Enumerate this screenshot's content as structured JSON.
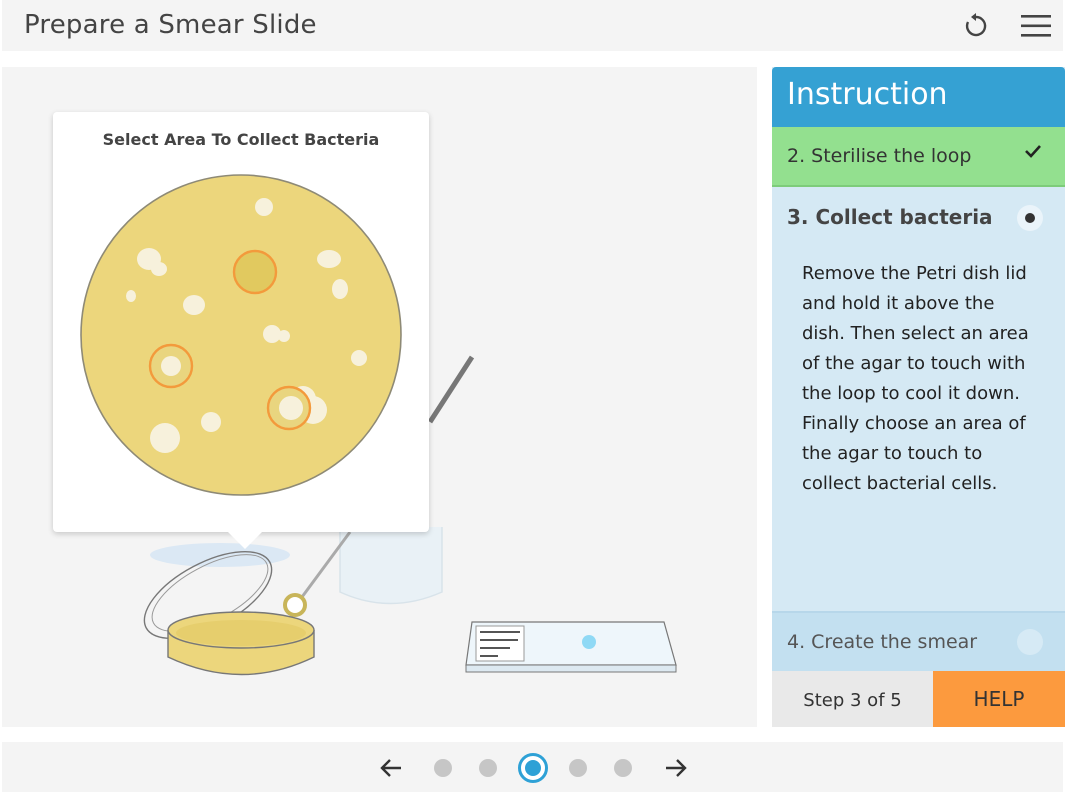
{
  "app": {
    "title": "Prepare a Smear Slide"
  },
  "toolbar": {
    "reset_icon": "reset-icon",
    "menu_icon": "menu-icon"
  },
  "popup": {
    "title": "Select Area To Collect Bacteria"
  },
  "instructions": {
    "header": "Instruction",
    "completed_step": "2. Sterilise the loop",
    "current_step": {
      "title": "3. Collect bacteria",
      "text": "Remove the Petri dish lid and hold it above the dish. Then select an area of the agar to touch with the loop to cool it down. Finally choose an area of the agar to touch to collect bacterial cells."
    },
    "next_step": "4. Create the smear",
    "step_counter": "Step 3 of 5",
    "help_label": "HELP"
  },
  "pager": {
    "total": 5,
    "current": 3
  },
  "colors": {
    "accent": "#35a1d3",
    "done": "#93e08f",
    "help": "#fc9a3e",
    "agar": "#ecd67c"
  }
}
